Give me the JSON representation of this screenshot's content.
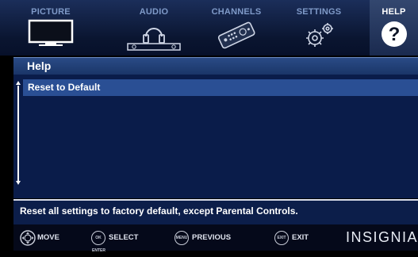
{
  "tabs": [
    {
      "label": "PICTURE",
      "icon": "tv-icon",
      "active": false
    },
    {
      "label": "AUDIO",
      "icon": "headphones-icon",
      "active": false
    },
    {
      "label": "CHANNELS",
      "icon": "remote-icon",
      "active": false
    },
    {
      "label": "SETTINGS",
      "icon": "gears-icon",
      "active": false
    },
    {
      "label": "HELP",
      "icon": "question-icon",
      "active": true
    }
  ],
  "panel": {
    "title": "Help",
    "items": [
      {
        "label": "Reset to Default",
        "selected": true
      }
    ]
  },
  "description": "Reset all settings to factory default, except Parental Controls.",
  "footer": {
    "hints": [
      {
        "icon": "dpad-icon",
        "key": "",
        "label": "MOVE"
      },
      {
        "icon": "ok-enter-icon",
        "key": "OK ENTER",
        "label": "SELECT"
      },
      {
        "icon": "menu-button-icon",
        "key": "MENU",
        "label": "PREVIOUS"
      },
      {
        "icon": "exit-button-icon",
        "key": "EXIT",
        "label": "EXIT"
      }
    ],
    "brand": "INSIGNIA"
  },
  "colors": {
    "accent": "#2a4f94",
    "panel": "#0a1c4a",
    "header": "#1a3568"
  }
}
